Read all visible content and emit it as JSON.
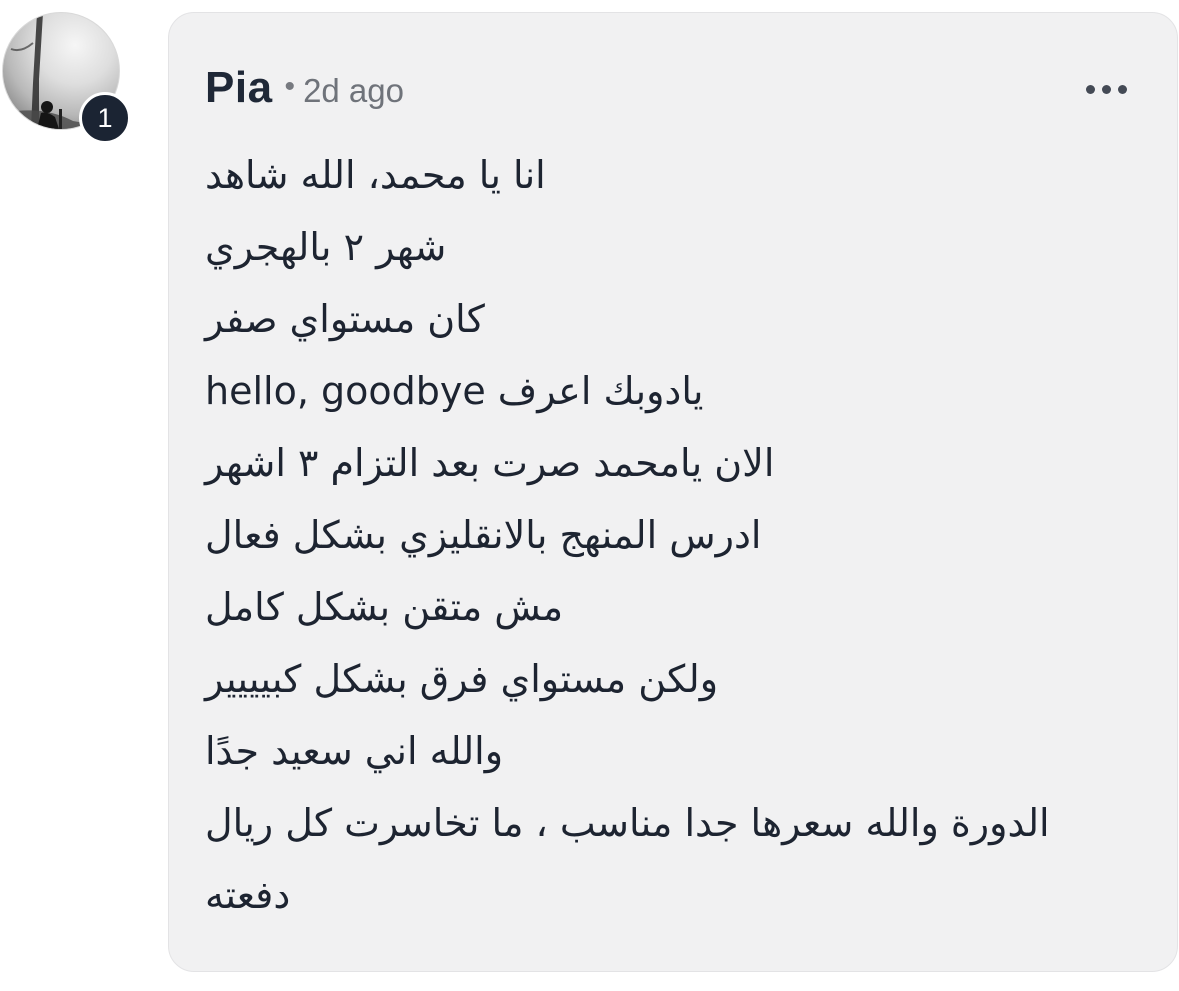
{
  "comment": {
    "author": "Pia",
    "separator": "•",
    "timestamp": "2d ago",
    "badge_count": "1",
    "more_icon": "ellipsis-horizontal-icon",
    "lines": [
      "انا يا محمد، الله شاهد",
      "شهر ٢ بالهجري",
      "كان مستواي صفر",
      "يادوبك اعرف hello, goodbye",
      "الان يامحمد صرت بعد التزام ٣ اشهر",
      "ادرس المنهج بالانقليزي بشكل فعال",
      "مش متقن بشكل كامل",
      "ولكن مستواي فرق بشكل كبيييير",
      "والله اني سعيد جدًا",
      "الدورة والله سعرها جدا مناسب ، ما تخاسرت كل ريال",
      "دفعته"
    ]
  },
  "colors": {
    "bubble_bg": "#f1f1f2",
    "author_text": "#1f2837",
    "meta_text": "#6f737a",
    "badge_bg": "#1b2433"
  }
}
